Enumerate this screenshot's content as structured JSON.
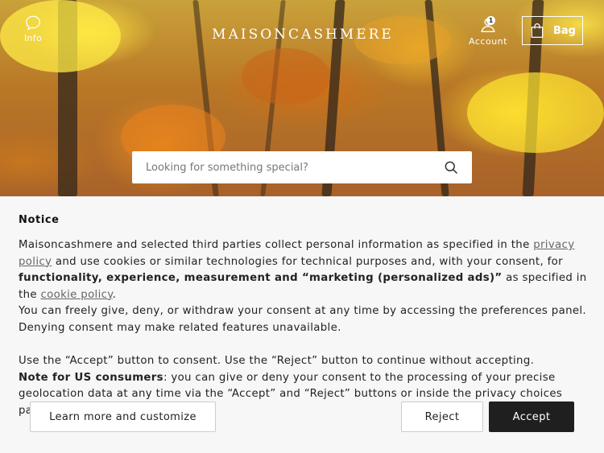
{
  "header": {
    "info_label": "Info",
    "logo_text": "MAISONCASHMERE",
    "account_label": "Account",
    "account_badge": "1",
    "bag_label": "Bag"
  },
  "search": {
    "placeholder": "Looking for something special?"
  },
  "notice": {
    "title": "Notice",
    "p1_a": "Maisoncashmere and selected third parties collect personal information as specified in the ",
    "privacy_link": "privacy policy",
    "p1_b": " and use cookies or similar technologies for technical purposes and, with your consent, for ",
    "p1_bold": "functionality, experience, measurement and “marketing (personalized ads)”",
    "p1_c": " as specified in the ",
    "cookie_link": "cookie policy",
    "p1_d": ".",
    "p2": "You can freely give, deny, or withdraw your consent at any time by accessing the preferences panel. Denying consent may make related features unavailable.",
    "p3": "Use the “Accept” button to consent. Use the “Reject” button to continue without accepting.",
    "p4_bold": "Note for US consumers",
    "p4": ": you can give or deny your consent to the processing of your precise geolocation data at any time via the “Accept” and “Reject” buttons or inside the privacy choices panel.",
    "learn_more_label": "Learn more and customize",
    "reject_label": "Reject",
    "accept_label": "Accept"
  },
  "icons": {
    "info": "chat-bubble-icon",
    "account": "user-icon",
    "bag": "shopping-bag-icon",
    "search": "search-icon"
  },
  "colors": {
    "accept_bg": "#1f1f1f",
    "notice_bg": "#f7f7f7",
    "link": "#666666"
  }
}
